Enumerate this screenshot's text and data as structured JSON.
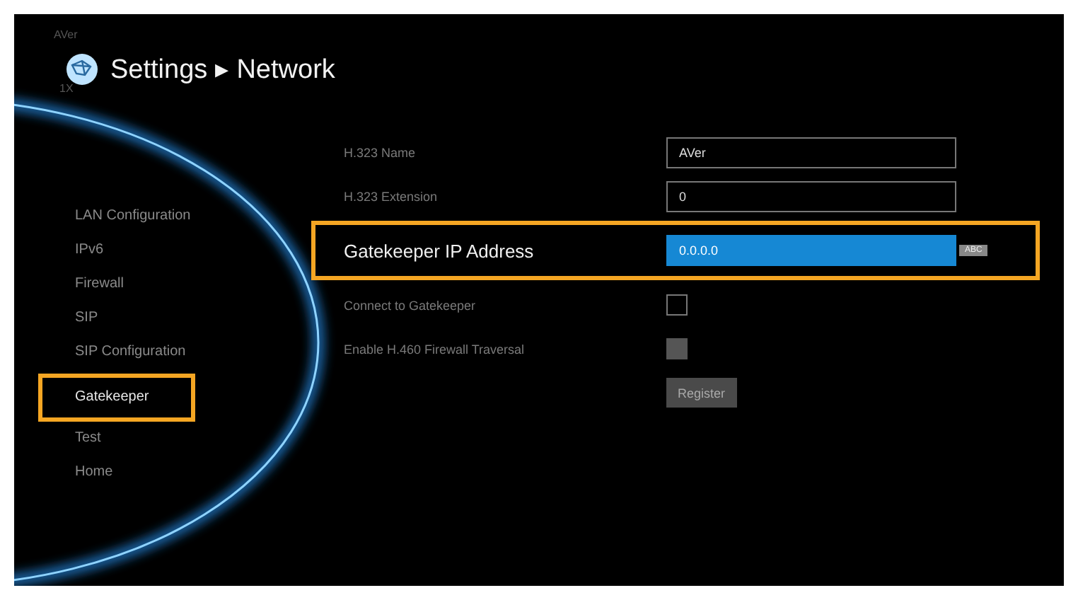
{
  "header": {
    "brand": "AVer",
    "brand_sub": "1X",
    "title": "Settings ▸ Network"
  },
  "sidebar": {
    "items": [
      {
        "label": "LAN Configuration",
        "selected": false
      },
      {
        "label": "IPv6",
        "selected": false
      },
      {
        "label": "Firewall",
        "selected": false
      },
      {
        "label": "SIP",
        "selected": false
      },
      {
        "label": "SIP Configuration",
        "selected": false
      },
      {
        "label": "Gatekeeper",
        "selected": true
      },
      {
        "label": "Test",
        "selected": false
      },
      {
        "label": "Home",
        "selected": false
      }
    ]
  },
  "form": {
    "rows": [
      {
        "kind": "text",
        "label": "H.323 Name",
        "value": "AVer",
        "selected": false
      },
      {
        "kind": "text",
        "label": "H.323 Extension",
        "value": "0",
        "selected": false
      },
      {
        "kind": "text",
        "label": "Gatekeeper IP Address",
        "value": "0.0.0.0",
        "selected": true,
        "input_mode": "ABC"
      },
      {
        "kind": "checkbox",
        "label": "Connect to Gatekeeper",
        "checked": false,
        "disabled": false
      },
      {
        "kind": "checkbox",
        "label": "Enable H.460 Firewall Traversal",
        "checked": false,
        "disabled": true
      },
      {
        "kind": "button",
        "label": "Register"
      }
    ]
  }
}
